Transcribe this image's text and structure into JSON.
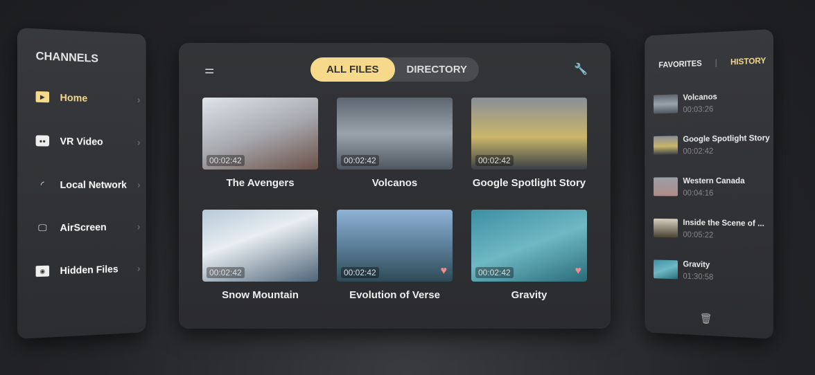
{
  "channels": {
    "title": "CHANNELS",
    "items": [
      {
        "label": "Home",
        "icon": "play-icon",
        "active": true
      },
      {
        "label": "VR Video",
        "icon": "vr-headset-icon"
      },
      {
        "label": "Local Network",
        "icon": "wifi-icon"
      },
      {
        "label": "AirScreen",
        "icon": "monitor-icon"
      },
      {
        "label": "Hidden Files",
        "icon": "hidden-folder-icon"
      }
    ]
  },
  "toolbar": {
    "filter_icon": "sliders-icon",
    "settings_icon": "wrench-icon",
    "tabs": [
      "ALL FILES",
      "DIRECTORY"
    ],
    "active_tab": "ALL FILES"
  },
  "videos": [
    {
      "title": "The Avengers",
      "duration": "00:02:42",
      "favorite": false
    },
    {
      "title": "Volcanos",
      "duration": "00:02:42",
      "favorite": false
    },
    {
      "title": "Google Spotlight Story",
      "duration": "00:02:42",
      "favorite": false
    },
    {
      "title": "Snow Mountain",
      "duration": "00:02:42",
      "favorite": false
    },
    {
      "title": "Evolution of Verse",
      "duration": "00:02:42",
      "favorite": true
    },
    {
      "title": "Gravity",
      "duration": "00:02:42",
      "favorite": true
    }
  ],
  "history": {
    "tabs": [
      "FAVORITES",
      "HISTORY"
    ],
    "active_tab": "HISTORY",
    "items": [
      {
        "title": "Volcanos",
        "duration": "00:03:26"
      },
      {
        "title": "Google Spotlight Story",
        "duration": "00:02:42"
      },
      {
        "title": "Western Canada",
        "duration": "00:04:16"
      },
      {
        "title": "Inside the Scene of ...",
        "duration": "00:05:22"
      },
      {
        "title": "Gravity",
        "duration": "01:30:58"
      }
    ],
    "delete_icon": "trash-icon"
  },
  "colors": {
    "accent": "#f6d98a",
    "favorite": "#f28c8c"
  }
}
